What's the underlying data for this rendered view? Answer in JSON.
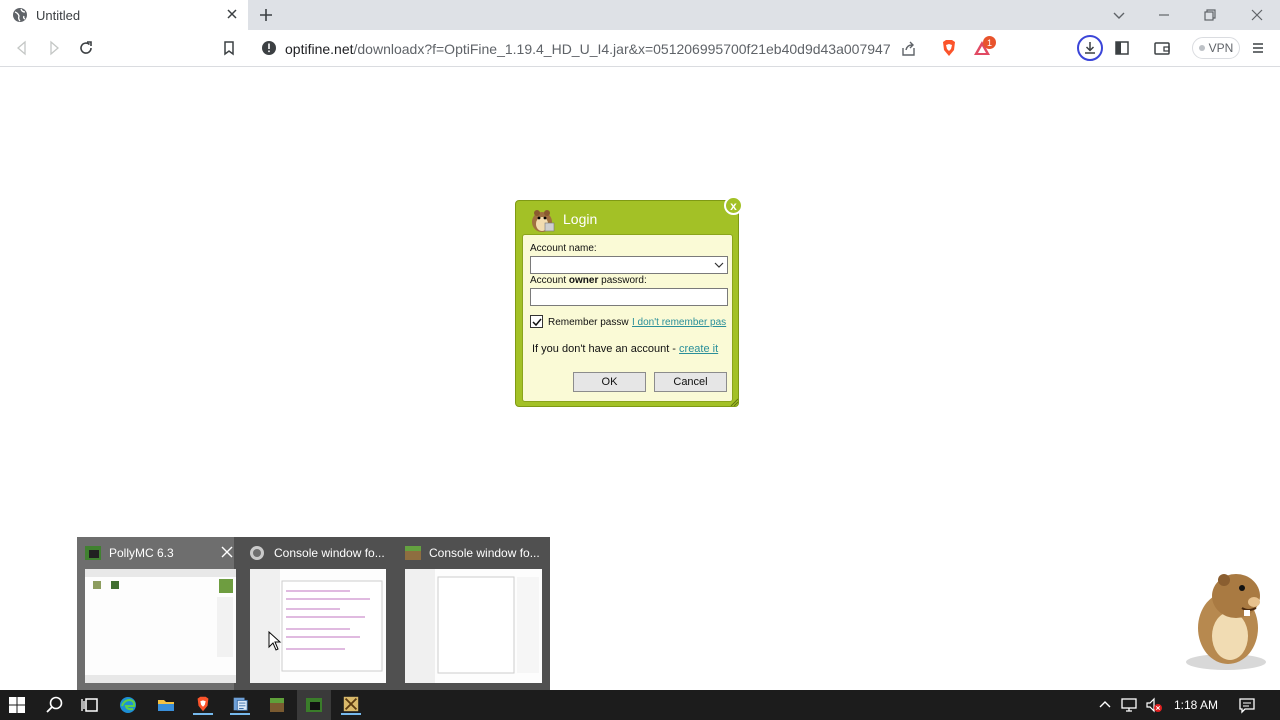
{
  "browser": {
    "tab_title": "Untitled",
    "url_host": "optifine.net",
    "url_path": "/downloadx?f=OptiFine_1.19.4_HD_U_I4.jar&x=051206995700f21eb40d9d43a007947d",
    "vpn_label": "VPN",
    "notification_count": "1"
  },
  "dialog": {
    "title": "Login",
    "close_label": "x",
    "account_name_label": "Account name:",
    "password_label_prefix": "Account ",
    "password_label_bold": "owner",
    "password_label_suffix": " password:",
    "account_name_value": "",
    "password_value": "",
    "remember_label": "Remember passw",
    "remember_checked": true,
    "forgot_link": "I don't remember pas",
    "no_account_text": "If you don't have an account - ",
    "create_link": "create it",
    "ok_label": "OK",
    "cancel_label": "Cancel"
  },
  "thumbnails": [
    {
      "title": "PollyMC 6.3",
      "icon": "pollymc-icon",
      "active": true
    },
    {
      "title": "Console window fo...",
      "icon": "console-icon",
      "active": false
    },
    {
      "title": "Console window fo...",
      "icon": "minecraft-icon",
      "active": false
    }
  ],
  "taskbar": {
    "time": "1:18 AM",
    "apps": [
      "start-icon",
      "search-icon",
      "task-view-icon",
      "edge-icon",
      "file-explorer-icon",
      "brave-icon",
      "document-app-icon",
      "minecraft-block-icon",
      "pollymc-icon",
      "launcher-icon"
    ]
  },
  "colors": {
    "dialog_green": "#a3c126",
    "dialog_body": "#fafad6",
    "link": "#2a8f9a",
    "taskbar": "#1c1c1c"
  }
}
